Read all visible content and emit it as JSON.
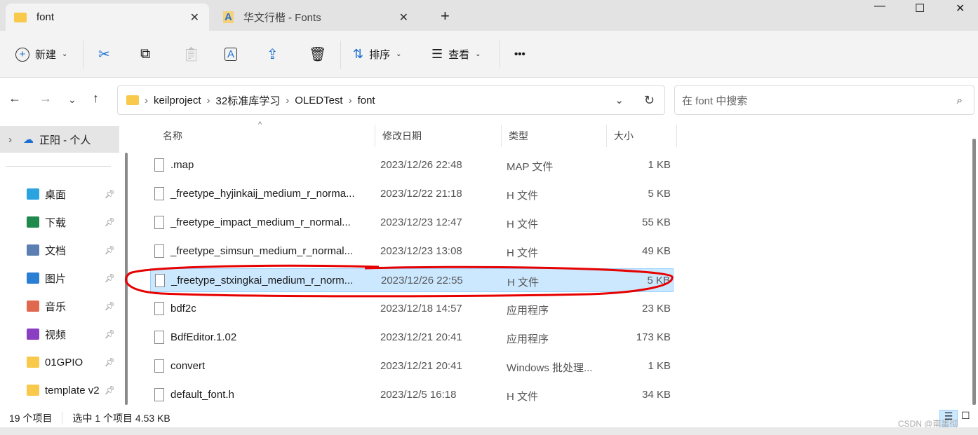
{
  "tabs": [
    {
      "label": "font",
      "active": true
    },
    {
      "label": "华文行楷 - Fonts",
      "active": false
    }
  ],
  "new_tab": "+",
  "window": {
    "minimize": "—",
    "maximize": "☐",
    "close": "✕"
  },
  "toolbar": {
    "new": "新建",
    "sort": "排序",
    "view": "查看",
    "more": "•••"
  },
  "breadcrumb": [
    "keilproject",
    "32标准库学习",
    "OLEDTest",
    "font"
  ],
  "search_placeholder": "在 font 中搜索",
  "sidebar": {
    "account": "正阳 - 个人",
    "items": [
      {
        "label": "桌面",
        "icon": "desktop-icon",
        "color": "#2aa3e0"
      },
      {
        "label": "下载",
        "icon": "download-icon",
        "color": "#1f8a4c"
      },
      {
        "label": "文档",
        "icon": "document-icon",
        "color": "#5a7fb0"
      },
      {
        "label": "图片",
        "icon": "pictures-icon",
        "color": "#2a7fd4"
      },
      {
        "label": "音乐",
        "icon": "music-icon",
        "color": "#e0684f"
      },
      {
        "label": "视频",
        "icon": "video-icon",
        "color": "#8a3fc2"
      },
      {
        "label": "01GPIO",
        "icon": "folder-icon",
        "color": "#f8c94b"
      },
      {
        "label": "template v2",
        "icon": "folder-icon",
        "color": "#f8c94b"
      }
    ]
  },
  "columns": [
    "名称",
    "修改日期",
    "类型",
    "大小"
  ],
  "files": [
    {
      "name": ".map",
      "date": "2023/12/26 22:48",
      "type": "MAP 文件",
      "size": "1 KB"
    },
    {
      "name": "_freetype_hyjinkaij_medium_r_norma...",
      "date": "2023/12/22 21:18",
      "type": "H 文件",
      "size": "5 KB"
    },
    {
      "name": "_freetype_impact_medium_r_normal...",
      "date": "2023/12/23 12:47",
      "type": "H 文件",
      "size": "55 KB"
    },
    {
      "name": "_freetype_simsun_medium_r_normal...",
      "date": "2023/12/23 13:08",
      "type": "H 文件",
      "size": "49 KB"
    },
    {
      "name": "_freetype_stxingkai_medium_r_norm...",
      "date": "2023/12/26 22:55",
      "type": "H 文件",
      "size": "5 KB",
      "selected": true
    },
    {
      "name": "bdf2c",
      "date": "2023/12/18 14:57",
      "type": "应用程序",
      "size": "23 KB"
    },
    {
      "name": "BdfEditor.1.02",
      "date": "2023/12/21 20:41",
      "type": "应用程序",
      "size": "173 KB"
    },
    {
      "name": "convert",
      "date": "2023/12/21 20:41",
      "type": "Windows 批处理...",
      "size": "1 KB"
    },
    {
      "name": "default_font.h",
      "date": "2023/12/5 16:18",
      "type": "H 文件",
      "size": "34 KB"
    }
  ],
  "status": {
    "count": "19 个项目",
    "selection": "选中 1 个项目  4.53 KB"
  },
  "watermark": "CSDN @南墨彻",
  "colors": {
    "selection": "#cce8ff",
    "annotation": "#e60000"
  }
}
